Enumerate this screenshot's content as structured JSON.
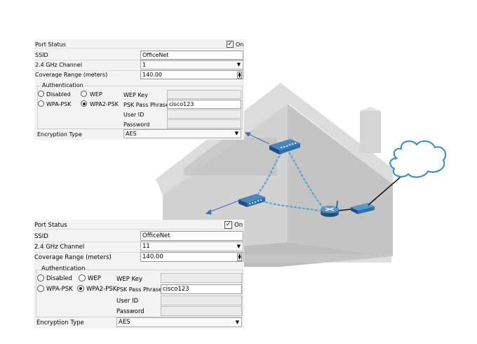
{
  "panels": [
    {
      "port_status_label": "Port Status",
      "port_status_on_label": "On",
      "port_status_checked": true,
      "ssid_label": "SSID",
      "ssid_value": "OfficeNet",
      "channel_label": "2.4 GHz Channel",
      "channel_value": "1",
      "coverage_label": "Coverage Range (meters)",
      "coverage_value": "140.00",
      "auth_group_label": "Authentication",
      "auth_options": {
        "disabled": "Disabled",
        "wep": "WEP",
        "wpa_psk": "WPA-PSK",
        "wpa2_psk": "WPA2-PSK"
      },
      "auth_selected": "wpa2_psk",
      "wep_key_label": "WEP Key",
      "psk_label": "PSK Pass Phrase",
      "psk_value": "cisco123",
      "user_id_label": "User ID",
      "password_label": "Password",
      "encryption_label": "Encryption Type",
      "encryption_value": "AES"
    },
    {
      "port_status_label": "Port Status",
      "port_status_on_label": "On",
      "port_status_checked": true,
      "ssid_label": "SSID",
      "ssid_value": "OfficeNet",
      "channel_label": "2.4 GHz Channel",
      "channel_value": "11",
      "coverage_label": "Coverage Range (meters)",
      "coverage_value": "140.00",
      "auth_group_label": "Authentication",
      "auth_options": {
        "disabled": "Disabled",
        "wep": "WEP",
        "wpa_psk": "WPA-PSK",
        "wpa2_psk": "WPA2-PSK"
      },
      "auth_selected": "wpa2_psk",
      "wep_key_label": "WEP Key",
      "psk_label": "PSK Pass Phrase",
      "psk_value": "cisco123",
      "user_id_label": "User ID",
      "password_label": "Password",
      "encryption_label": "Encryption Type",
      "encryption_value": "AES"
    }
  ],
  "colors": {
    "house_front": "#d0d0d0",
    "house_side": "#c2c2c2",
    "house_roof": "#e2e2e2",
    "device_blue": "#2f6fa8",
    "wave_blue": "#4aa3d8",
    "cloud_stroke": "#2c8ec9",
    "arrow_blue": "#3a6fb0"
  }
}
